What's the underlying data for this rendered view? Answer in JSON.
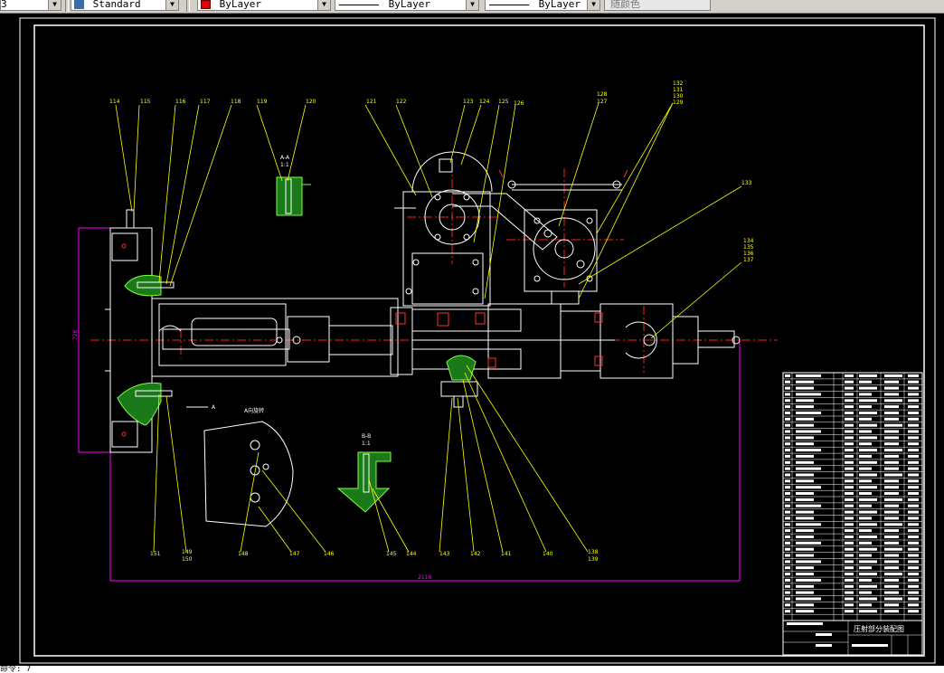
{
  "toolbar": {
    "first_value": "3",
    "text_style": "Standard",
    "color": "ByLayer",
    "color_hex": "#e00000",
    "linetype": "ByLayer",
    "lineweight": "ByLayer",
    "plot_style": "随颜色"
  },
  "drawing": {
    "title": "压射部分装配图",
    "section_aa_label": "A-A",
    "section_aa_scale": "1:1",
    "section_bb_label": "B-B",
    "section_bb_scale": "1:1",
    "view_note": "A向旋转",
    "arrow_label": "A",
    "dim_width": "2116",
    "dim_height": "726",
    "balloons_top": [
      "114",
      "115",
      "116",
      "117",
      "118",
      "119",
      "120",
      "121",
      "122",
      "123",
      "124",
      "125",
      "126",
      "128",
      "127"
    ],
    "balloons_stack_a": [
      "132",
      "131",
      "130",
      "129"
    ],
    "balloons_single": [
      "133"
    ],
    "balloons_stack_b": [
      "134",
      "135",
      "136",
      "137"
    ],
    "balloons_bottom": [
      "151",
      "149",
      "150",
      "148",
      "147",
      "146",
      "145",
      "144",
      "143",
      "142",
      "141",
      "140",
      "138",
      "139"
    ]
  },
  "command": {
    "text": "命令: 7"
  }
}
